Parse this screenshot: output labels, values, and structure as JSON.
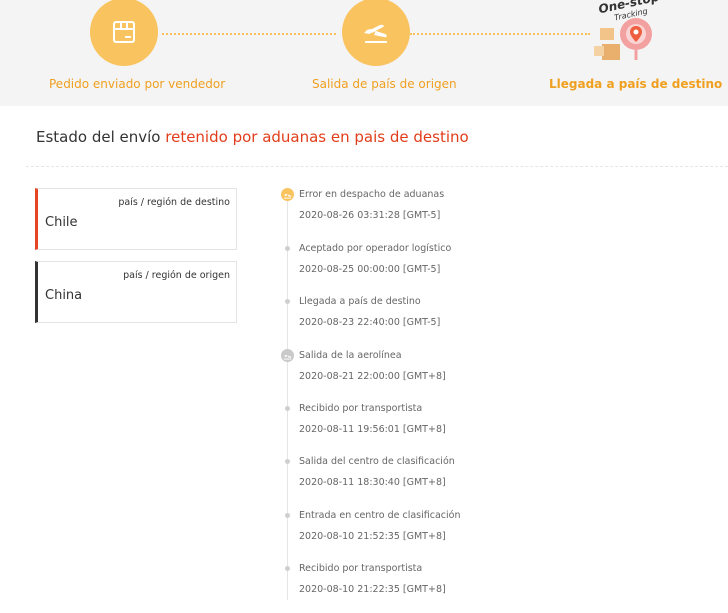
{
  "steps": [
    {
      "label": "Pedido enviado por vendedor",
      "icon": "box-icon"
    },
    {
      "label": "Salida de país de origen",
      "icon": "plane-departure-icon"
    },
    {
      "label": "Llegada a país de destino",
      "icon": "location-pin-icon"
    }
  ],
  "brand": {
    "line1": "One-stop",
    "line2": "Tracking"
  },
  "status": {
    "prefix": "Estado del envío ",
    "highlight": "retenido por aduanas en pais de destino"
  },
  "cards": [
    {
      "caption": "país / región de destino",
      "country": "Chile"
    },
    {
      "caption": "país / región de origen",
      "country": "China"
    }
  ],
  "timeline": [
    {
      "title": "Error en despacho de aduanas",
      "time": "2020-08-26 03:31:28 [GMT-5]"
    },
    {
      "title": "Aceptado por operador logístico",
      "time": "2020-08-25 00:00:00 [GMT-5]"
    },
    {
      "title": "Llegada a país de destino",
      "time": "2020-08-23 22:40:00 [GMT-5]"
    },
    {
      "title": "Salida de la aerolínea",
      "time": "2020-08-21 22:00:00 [GMT+8]"
    },
    {
      "title": "Recibido por transportista",
      "time": "2020-08-11 19:56:01 [GMT+8]"
    },
    {
      "title": "Salida del centro de clasificación",
      "time": "2020-08-11 18:30:40 [GMT+8]"
    },
    {
      "title": "Entrada en centro de clasificación",
      "time": "2020-08-10 21:52:35 [GMT+8]"
    },
    {
      "title": "Recibido por transportista",
      "time": "2020-08-10 21:22:35 [GMT+8]"
    }
  ],
  "colors": {
    "accent": "#f9c35f",
    "label": "#f0a020",
    "alert": "#e23d1a",
    "dest_border": "#e64524"
  }
}
